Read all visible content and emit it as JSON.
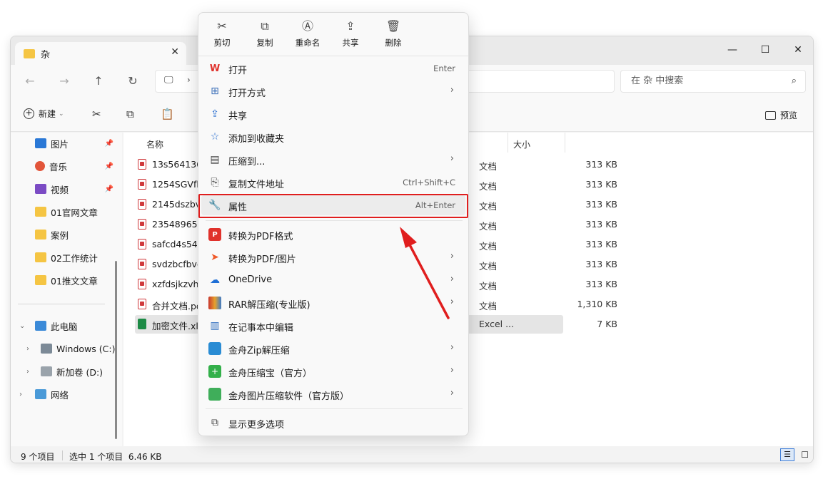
{
  "window": {
    "tab_title": "杂",
    "search_placeholder": "在 杂 中搜索"
  },
  "toolbar": {
    "new_label": "新建",
    "preview_label": "预览"
  },
  "sidebar": {
    "items": [
      {
        "label": "图片"
      },
      {
        "label": "音乐"
      },
      {
        "label": "视频"
      },
      {
        "label": "01官网文章"
      },
      {
        "label": "案例"
      },
      {
        "label": "02工作统计"
      },
      {
        "label": "01推文文章"
      },
      {
        "label": "此电脑"
      },
      {
        "label": "Windows (C:)"
      },
      {
        "label": "新加卷 (D:)"
      },
      {
        "label": "网络"
      }
    ]
  },
  "columns": {
    "name": "名称",
    "size": "大小"
  },
  "files": [
    {
      "name": "13s5641364",
      "type": "文档",
      "size": "313 KB"
    },
    {
      "name": "1254SGVfb",
      "type": "文档",
      "size": "313 KB"
    },
    {
      "name": "2145dszbv",
      "type": "文档",
      "size": "313 KB"
    },
    {
      "name": "235489652",
      "type": "文档",
      "size": "313 KB"
    },
    {
      "name": "safcd4s541",
      "type": "文档",
      "size": "313 KB"
    },
    {
      "name": "svdzbcfbvg",
      "type": "文档",
      "size": "313 KB"
    },
    {
      "name": "xzfdsjkzvhr",
      "type": "文档",
      "size": "313 KB"
    },
    {
      "name": "合并文档.pd",
      "type": "文档",
      "size": "1,310 KB"
    },
    {
      "name": "加密文件.xls",
      "type": "Excel ...",
      "size": "7 KB"
    }
  ],
  "status": {
    "count": "9 个项目",
    "selection": "选中 1 个项目  6.46 KB"
  },
  "context_menu": {
    "quick_actions": [
      "剪切",
      "复制",
      "重命名",
      "共享",
      "删除"
    ],
    "items": [
      {
        "label": "打开",
        "shortcut": "Enter"
      },
      {
        "label": "打开方式"
      },
      {
        "label": "共享"
      },
      {
        "label": "添加到收藏夹"
      },
      {
        "label": "压缩到..."
      },
      {
        "label": "复制文件地址",
        "shortcut": "Ctrl+Shift+C"
      },
      {
        "label": "属性",
        "shortcut": "Alt+Enter"
      },
      {
        "label": "转换为PDF格式"
      },
      {
        "label": "转换为PDF/图片"
      },
      {
        "label": "OneDrive"
      },
      {
        "label": "RAR解压缩(专业版)"
      },
      {
        "label": "在记事本中编辑"
      },
      {
        "label": "金舟Zip解压缩"
      },
      {
        "label": "金舟压缩宝（官方）"
      },
      {
        "label": "金舟图片压缩软件（官方版）"
      },
      {
        "label": "显示更多选项"
      }
    ]
  },
  "colors": {
    "highlight": "#e01e1e",
    "folder": "#f5c543",
    "excel": "#1d8b46",
    "pdf": "#d0393c"
  }
}
